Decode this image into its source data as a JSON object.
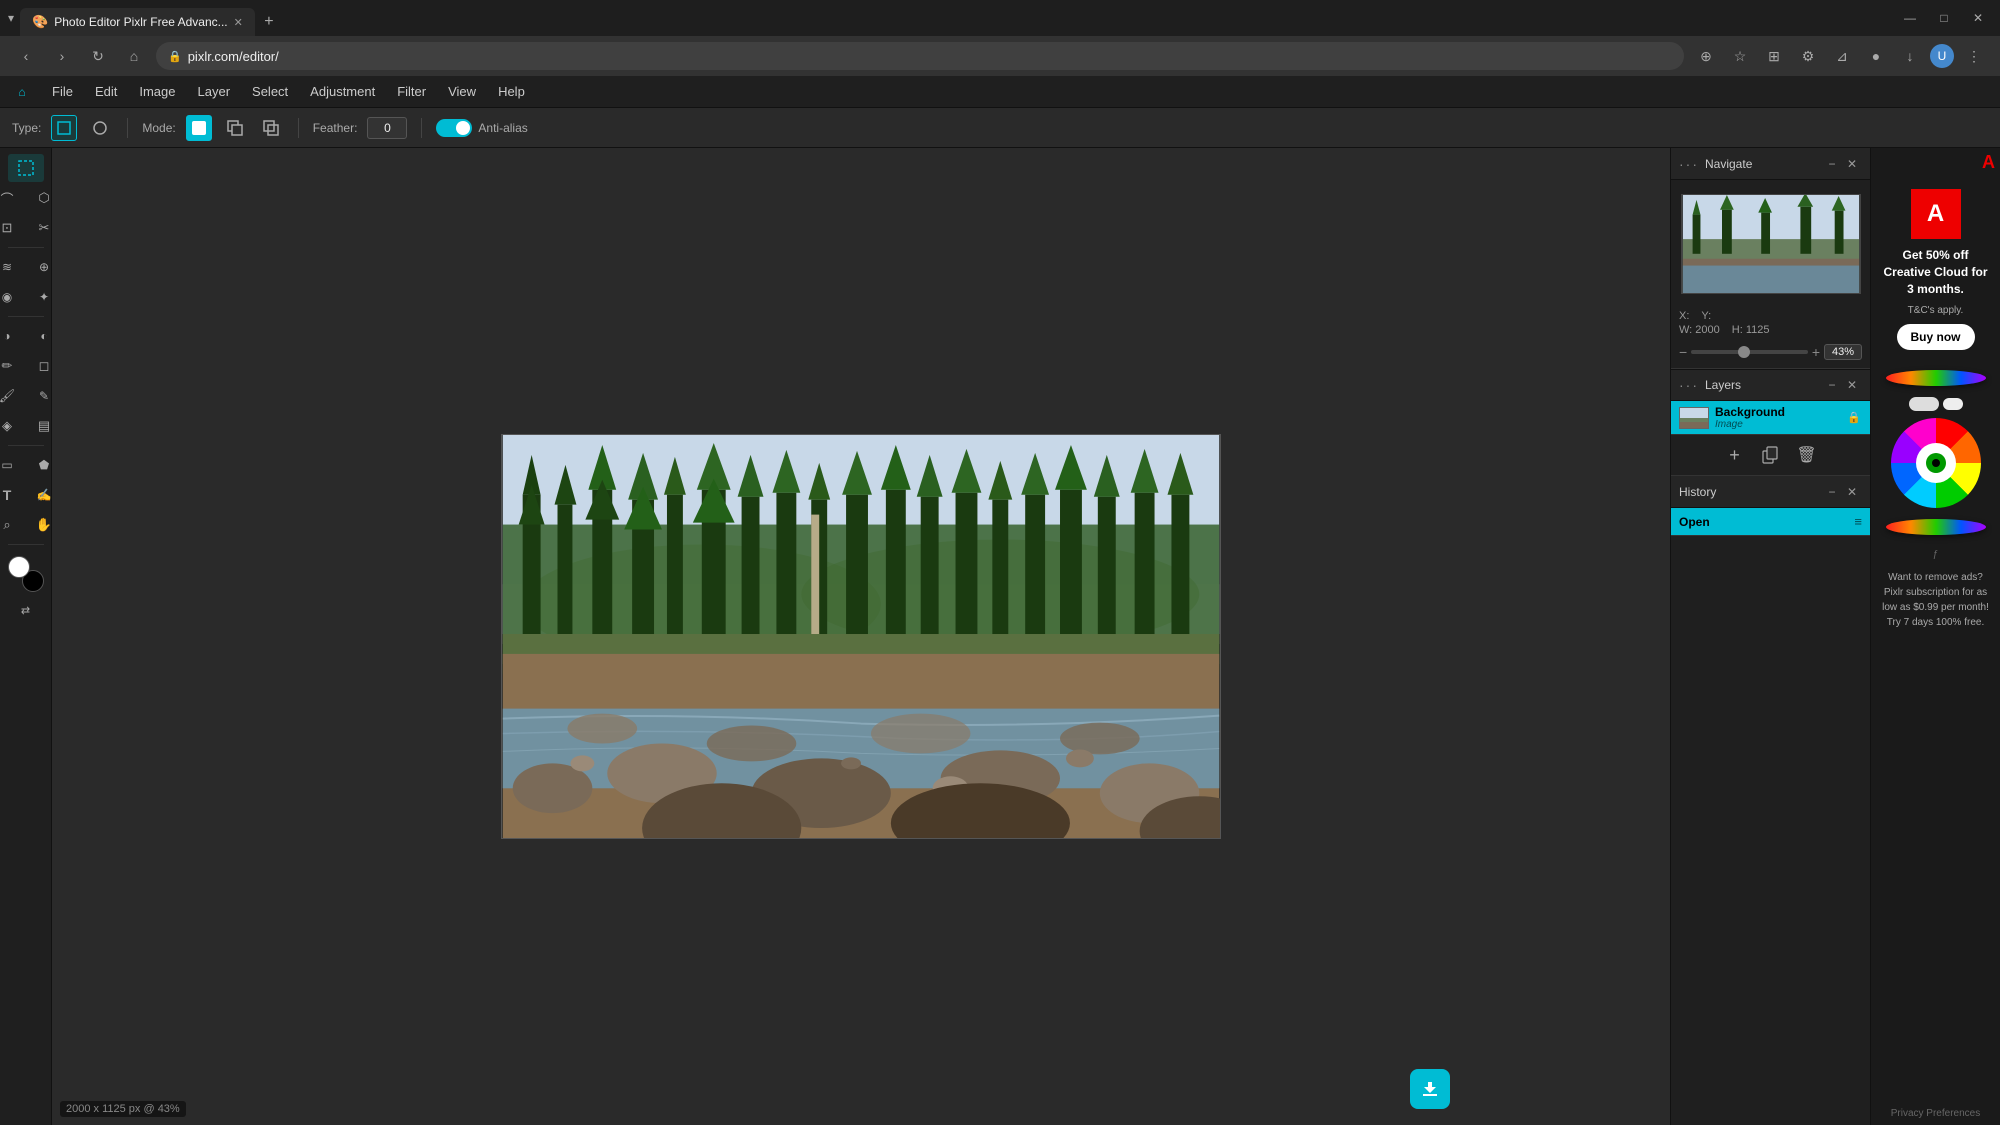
{
  "browser": {
    "tab_title": "Photo Editor Pixlr Free Advanc...",
    "url": "pixlr.com/editor/",
    "new_tab_label": "+",
    "nav": {
      "back": "‹",
      "forward": "›",
      "refresh": "↻",
      "home": "⌂"
    },
    "win_controls": {
      "minimize": "—",
      "maximize": "□",
      "close": "✕"
    }
  },
  "menu": {
    "items": [
      "File",
      "Edit",
      "Image",
      "Layer",
      "Select",
      "Adjustment",
      "Filter",
      "View",
      "Help"
    ]
  },
  "toolbar": {
    "home_icon": "⌂",
    "type_label": "Type:",
    "rect_icon": "□",
    "circle_icon": "○",
    "mode_label": "Mode:",
    "mode_add": "+",
    "mode_sub": "-",
    "mode_int": "×",
    "feather_label": "Feather:",
    "feather_value": "0",
    "antialias_label": "Anti-alias"
  },
  "tools": [
    {
      "id": "marquee",
      "icon": "⬚",
      "label": "Marquee"
    },
    {
      "id": "lasso",
      "icon": "⌒",
      "label": "Lasso"
    },
    {
      "id": "crop",
      "icon": "⊡",
      "label": "Crop"
    },
    {
      "id": "heal",
      "icon": "✱",
      "label": "Heal"
    },
    {
      "id": "blur",
      "icon": "≈",
      "label": "Blur"
    },
    {
      "id": "clone",
      "icon": "⊕",
      "label": "Clone"
    },
    {
      "id": "eraser",
      "icon": "◻",
      "label": "Eraser"
    },
    {
      "id": "globe",
      "icon": "⊙",
      "label": "Globe"
    },
    {
      "id": "dodge",
      "icon": "◑",
      "label": "Dodge"
    },
    {
      "id": "pen",
      "icon": "✏",
      "label": "Pen"
    },
    {
      "id": "brush",
      "icon": "🖌",
      "label": "Brush"
    },
    {
      "id": "fill",
      "icon": "◈",
      "label": "Fill"
    },
    {
      "id": "rect-shape",
      "icon": "▭",
      "label": "Rectangle Shape"
    },
    {
      "id": "text",
      "icon": "T",
      "label": "Text"
    },
    {
      "id": "magnify",
      "icon": "⌕",
      "label": "Magnify"
    },
    {
      "id": "hand",
      "icon": "✋",
      "label": "Hand"
    }
  ],
  "navigate": {
    "title": "Navigate",
    "x_label": "X:",
    "x_value": "",
    "y_label": "Y:",
    "y_value": "",
    "w_label": "W:",
    "w_value": "2000",
    "h_label": "H:",
    "h_value": "1125",
    "zoom_percent": "43%",
    "zoom_min": "−",
    "zoom_max": "+"
  },
  "layers": {
    "title": "Layers",
    "items": [
      {
        "name": "Background",
        "type": "Image",
        "locked": true,
        "active": true
      }
    ],
    "actions": {
      "add": "+",
      "duplicate": "⧉",
      "delete": "🗑"
    }
  },
  "history": {
    "title": "History",
    "items": [
      {
        "label": "Open",
        "icon": "≡"
      }
    ]
  },
  "ad": {
    "logo": "Adobe",
    "headline": "Get 50% off Creative Cloud for 3 months.",
    "fine_print": "T&C's apply.",
    "button": "Buy now",
    "promo_text": "Want to remove ads? Pixlr subscription for as low as $0.99 per month! Try 7 days 100% free.",
    "privacy": "Privacy Preferences"
  },
  "canvas": {
    "status": "2000 x 1125 px @ 43%"
  },
  "colors": {
    "teal": "#00bcd4",
    "dark_bg": "#1f1f1f",
    "panel_bg": "#252525",
    "canvas_bg": "#2a2a2a",
    "toolbar_bg": "#2a2a2a"
  }
}
